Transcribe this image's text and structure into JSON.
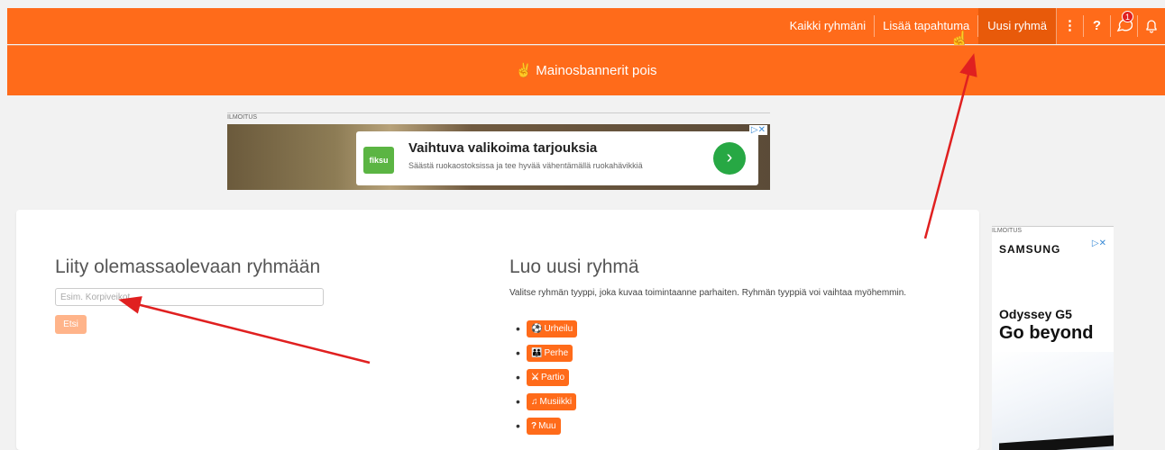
{
  "nav": {
    "links": [
      "Kaikki ryhmäni",
      "Lisää tapahtuma",
      "Uusi ryhmä"
    ],
    "active_index": 2,
    "icons": [
      "more-vertical-icon",
      "help-icon",
      "chat-icon",
      "bell-icon"
    ],
    "notification_count": "1"
  },
  "banner": {
    "text": "Mainosbannerit pois",
    "icon": "peace-hand-icon"
  },
  "ad_top": {
    "label": "ILMOITUS",
    "logo": "fiksu",
    "title": "Vaihtuva valikoima tarjouksia",
    "subtitle": "Säästä ruokaostoksissa ja tee hyvää vähentämällä ruokahävikkiä"
  },
  "join": {
    "title": "Liity olemassaolevaan ryhmään",
    "placeholder": "Esim. Korpiveikot",
    "button": "Etsi"
  },
  "create": {
    "title": "Luo uusi ryhmä",
    "description": "Valitse ryhmän tyyppi, joka kuvaa toimintaanne parhaiten. Ryhmän tyyppiä voi vaihtaa myöhemmin.",
    "types": [
      {
        "label": "Urheilu",
        "icon": "ball-icon"
      },
      {
        "label": "Perhe",
        "icon": "family-icon"
      },
      {
        "label": "Partio",
        "icon": "knife-icon"
      },
      {
        "label": "Musiikki",
        "icon": "music-icon"
      },
      {
        "label": "Muu",
        "icon": "question-icon"
      }
    ]
  },
  "ad_side": {
    "label": "ILMOITUS",
    "brand": "SAMSUNG",
    "product": "Odyssey G5",
    "tagline": "Go beyond"
  },
  "colors": {
    "brand": "#ff6b1a",
    "brand_dark": "#e85a0a",
    "button_disabled": "#ffb48a",
    "annotation": "#e02020"
  }
}
